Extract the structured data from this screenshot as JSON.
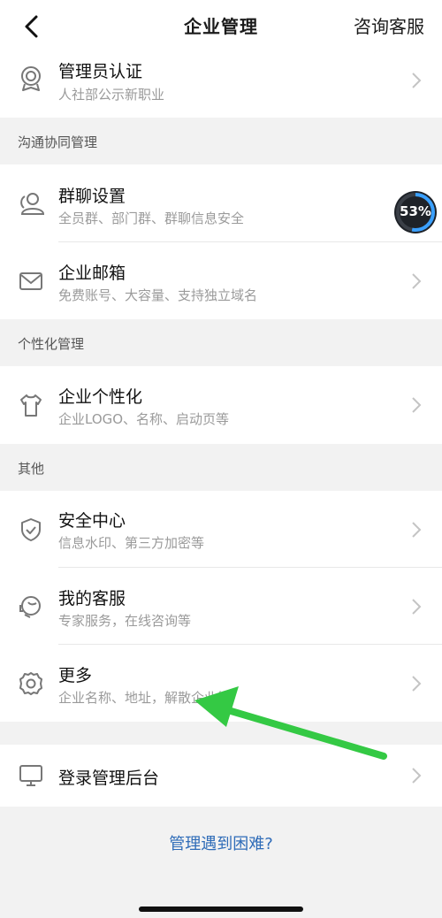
{
  "nav": {
    "title": "企业管理",
    "action": "咨询客服"
  },
  "top_item": {
    "label": "管理员认证",
    "sub": "人社部公示新职业"
  },
  "sections": {
    "comm": "沟通协同管理",
    "personal": "个性化管理",
    "other": "其他"
  },
  "items": {
    "group_chat": {
      "label": "群聊设置",
      "sub": "全员群、部门群、群聊信息安全"
    },
    "mail": {
      "label": "企业邮箱",
      "sub": "免费账号、大容量、支持独立域名"
    },
    "personalize": {
      "label": "企业个性化",
      "sub": "企业LOGO、名称、启动页等"
    },
    "security": {
      "label": "安全中心",
      "sub": "信息水印、第三方加密等"
    },
    "service": {
      "label": "我的客服",
      "sub": "专家服务，在线咨询等"
    },
    "more": {
      "label": "更多",
      "sub": "企业名称、地址，解散企业等"
    },
    "login": {
      "label": "登录管理后台"
    }
  },
  "help_link": "管理遇到困难?",
  "badge": {
    "text": "53%",
    "value": 0.53
  },
  "colors": {
    "link": "#2f6cb8",
    "arrow": "#34c944",
    "background": "#f2f2f2"
  }
}
